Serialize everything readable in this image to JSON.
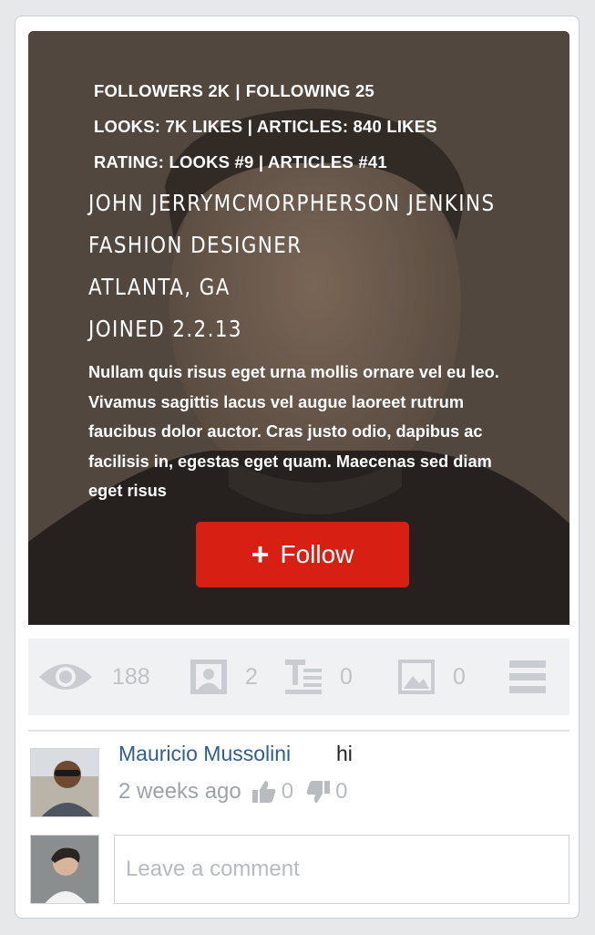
{
  "profile": {
    "stats": {
      "followers": "FOLLOWERS 2K",
      "following": "FOLLOWING 25",
      "likes": "LOOKS: 7K LIKES | ARTICLES: 840 LIKES",
      "rating": "RATING: LOOKS #9 | ARTICLES #41",
      "separator": "|"
    },
    "name": "JOHN JERRYMCMORPHERSON JENKINS",
    "occupation": "FASHION DESIGNER",
    "location": "ATLANTA, GA",
    "joined": "JOINED 2.2.13",
    "bio": "Nullam quis risus eget urna mollis ornare vel eu leo. Vivamus sagittis lacus vel augue laoreet rutrum faucibus dolor auctor. Cras justo odio, dapibus ac facilisis in, egestas eget quam. Maecenas sed diam eget risus",
    "follow_label": "Follow",
    "follow_icon": "plus-icon"
  },
  "toolbar": {
    "views": "188",
    "looks": "2",
    "articles": "0",
    "photos": "0",
    "icons": [
      "eye-icon",
      "portrait-icon",
      "article-icon",
      "image-icon",
      "menu-icon"
    ]
  },
  "comments": [
    {
      "author": "Mauricio Mussolini",
      "text": "hi",
      "time": "2 weeks ago",
      "likes": "0",
      "dislikes": "0"
    }
  ],
  "comment_box": {
    "placeholder": "Leave a comment"
  },
  "colors": {
    "follow_button": "#d81f14",
    "author_link": "#2d5e94",
    "toolbar_bg": "#f0f1f3",
    "muted": "#bfc2c6"
  }
}
